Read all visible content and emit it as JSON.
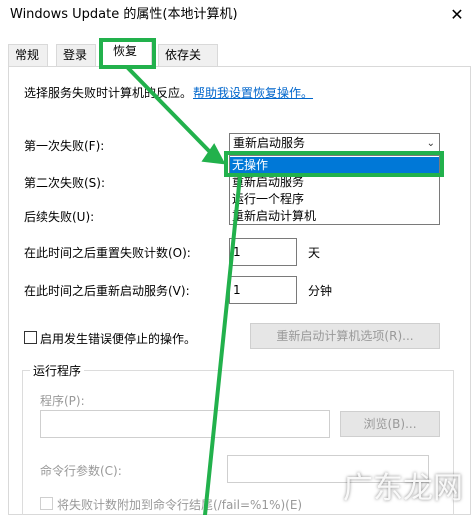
{
  "window": {
    "title": "Windows Update 的属性(本地计算机)",
    "close_label": "✕"
  },
  "tabs": [
    {
      "label": "常规"
    },
    {
      "label": "登录"
    },
    {
      "label": "恢复"
    },
    {
      "label": "依存关系"
    }
  ],
  "recovery": {
    "intro": "选择服务失败时计算机的反应。",
    "help_link": "帮助我设置恢复操作。",
    "first_failure_label": "第一次失败(F):",
    "first_failure_value": "重新启动服务",
    "second_failure_label": "第二次失败(S):",
    "subsequent_failure_label": "后续失败(U):",
    "reset_count_label": "在此时间之后重置失败计数(O):",
    "reset_count_value": "1",
    "reset_count_unit": "天",
    "restart_after_label": "在此时间之后重新启动服务(V):",
    "restart_after_value": "1",
    "restart_after_unit": "分钟",
    "enable_actions_label": "启用发生错误便停止的操作。",
    "restart_computer_button": "重新启动计算机选项(R)...",
    "run_program_group": "运行程序",
    "program_label": "程序(P):",
    "browse_button": "浏览(B)...",
    "command_params_label": "命令行参数(C):",
    "append_fail_count_label": "将失败计数附加到命令行结尾(/fail=%1%)(E)"
  },
  "dropdown": {
    "options": [
      "无操作",
      "重新启动服务",
      "运行一个程序",
      "重新启动计算机"
    ],
    "selected": "无操作"
  },
  "watermark": "广东龙网",
  "colors": {
    "highlight": "#22b14c",
    "selection": "#0078d7",
    "link": "#0066cc"
  }
}
